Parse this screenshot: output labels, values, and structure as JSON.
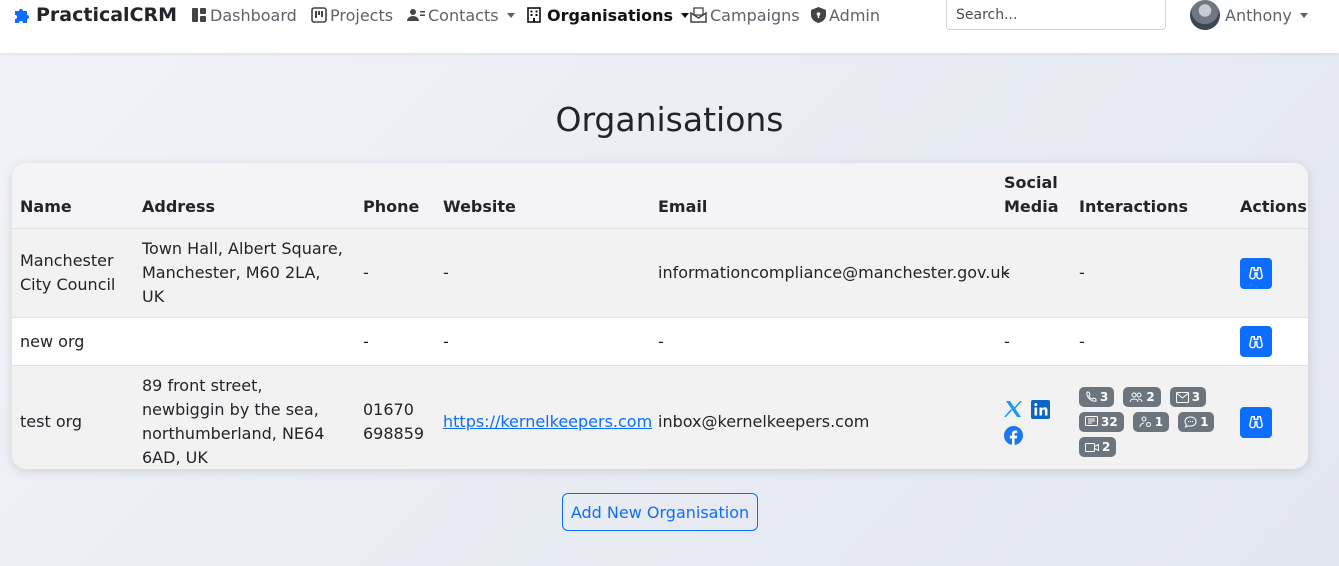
{
  "nav": {
    "brand": "PracticalCRM",
    "links": [
      {
        "label": "Dashboard"
      },
      {
        "label": "Projects"
      },
      {
        "label": "Contacts"
      },
      {
        "label": "Organisations"
      },
      {
        "label": "Campaigns"
      },
      {
        "label": "Admin"
      }
    ],
    "search_placeholder": "Search...",
    "user_name": "Anthony"
  },
  "page": {
    "title": "Organisations",
    "add_button_label": "Add New Organisation"
  },
  "table": {
    "headers": {
      "name": "Name",
      "address": "Address",
      "phone": "Phone",
      "website": "Website",
      "email": "Email",
      "social": "Social Media",
      "interactions": "Interactions",
      "actions": "Actions"
    },
    "rows": [
      {
        "name": "Manchester City Council",
        "address": "Town Hall, Albert Square, Manchester, M60 2LA, UK",
        "phone": "-",
        "website": "-",
        "email": "informationcompliance@manchester.gov.uk",
        "social": "-",
        "interactions": "-"
      },
      {
        "name": "new org",
        "address": "",
        "phone": "-",
        "website": "-",
        "email": "-",
        "social": "-",
        "interactions": "-"
      },
      {
        "name": "test org",
        "address": "89 front street, newbiggin by the sea, northumberland, NE64 6AD, UK",
        "phone": "01670 698859",
        "website": "https://kernelkeepers.com",
        "email": "inbox@kernelkeepers.com",
        "social_icons": [
          "x-twitter-icon",
          "linkedin-icon",
          "facebook-icon"
        ],
        "interaction_badges": [
          {
            "icon": "phone-icon",
            "count": "3"
          },
          {
            "icon": "people-icon",
            "count": "2"
          },
          {
            "icon": "envelope-icon",
            "count": "3"
          },
          {
            "icon": "message-icon",
            "count": "32"
          },
          {
            "icon": "person-gear-icon",
            "count": "1"
          },
          {
            "icon": "chat-icon",
            "count": "1"
          },
          {
            "icon": "video-icon",
            "count": "2"
          }
        ]
      }
    ]
  },
  "colors": {
    "accent": "#0d6efd",
    "badge": "#6c757d",
    "twitter": "#1d9bf0",
    "linkedin": "#0a66c2",
    "facebook": "#1877f2"
  }
}
